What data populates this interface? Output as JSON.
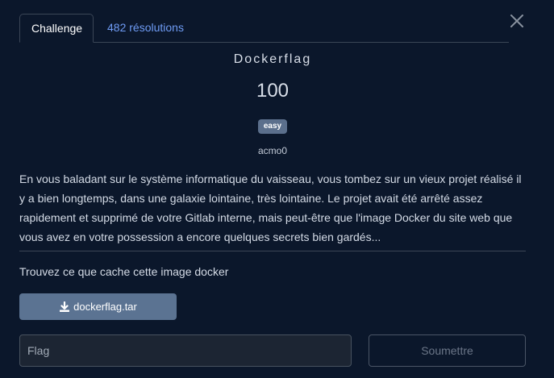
{
  "tabs": {
    "challenge": "Challenge",
    "solves": "482 résolutions"
  },
  "challenge": {
    "name": "Dockerflag",
    "points": "100",
    "difficulty": "easy",
    "author": "acmo0",
    "description": "En vous baladant sur le système informatique du vaisseau, vous tombez sur un vieux projet réalisé il y a bien longtemps, dans une galaxie lointaine, très lointaine. Le projet avait été arrêté assez rapidement et supprimé de votre Gitlab interne, mais peut-être que l'image Docker du site web que vous avez en votre possession a encore quelques secrets bien gardés...",
    "hint": "Trouvez ce que cache cette image docker",
    "file": "dockerflag.tar"
  },
  "form": {
    "placeholder": "Flag",
    "value": "",
    "submit": "Soumettre"
  },
  "icons": {
    "close": "close-icon",
    "download": "download-icon"
  },
  "colors": {
    "background": "#0b172b",
    "accent_link": "#6f9cf5",
    "badge": "#5b6f8c",
    "download_button": "#5b7392"
  }
}
